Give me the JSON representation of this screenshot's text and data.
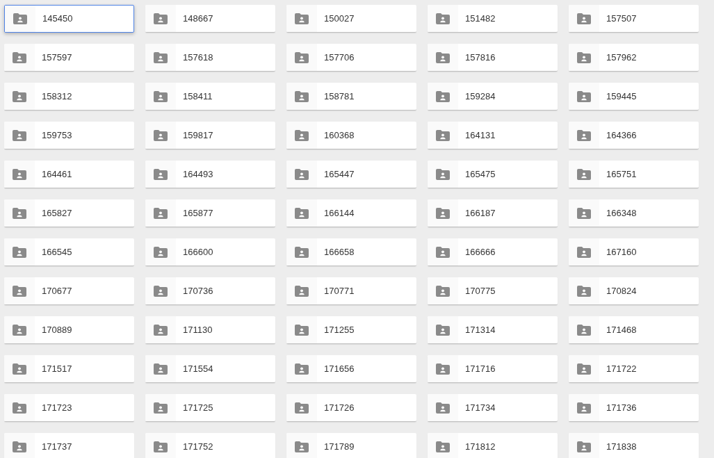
{
  "folders": [
    {
      "label": "145450",
      "selected": true
    },
    {
      "label": "148667",
      "selected": false
    },
    {
      "label": "150027",
      "selected": false
    },
    {
      "label": "151482",
      "selected": false
    },
    {
      "label": "157507",
      "selected": false
    },
    {
      "label": "157597",
      "selected": false
    },
    {
      "label": "157618",
      "selected": false
    },
    {
      "label": "157706",
      "selected": false
    },
    {
      "label": "157816",
      "selected": false
    },
    {
      "label": "157962",
      "selected": false
    },
    {
      "label": "158312",
      "selected": false
    },
    {
      "label": "158411",
      "selected": false
    },
    {
      "label": "158781",
      "selected": false
    },
    {
      "label": "159284",
      "selected": false
    },
    {
      "label": "159445",
      "selected": false
    },
    {
      "label": "159753",
      "selected": false
    },
    {
      "label": "159817",
      "selected": false
    },
    {
      "label": "160368",
      "selected": false
    },
    {
      "label": "164131",
      "selected": false
    },
    {
      "label": "164366",
      "selected": false
    },
    {
      "label": "164461",
      "selected": false
    },
    {
      "label": "164493",
      "selected": false
    },
    {
      "label": "165447",
      "selected": false
    },
    {
      "label": "165475",
      "selected": false
    },
    {
      "label": "165751",
      "selected": false
    },
    {
      "label": "165827",
      "selected": false
    },
    {
      "label": "165877",
      "selected": false
    },
    {
      "label": "166144",
      "selected": false
    },
    {
      "label": "166187",
      "selected": false
    },
    {
      "label": "166348",
      "selected": false
    },
    {
      "label": "166545",
      "selected": false
    },
    {
      "label": "166600",
      "selected": false
    },
    {
      "label": "166658",
      "selected": false
    },
    {
      "label": "166666",
      "selected": false
    },
    {
      "label": "167160",
      "selected": false
    },
    {
      "label": "170677",
      "selected": false
    },
    {
      "label": "170736",
      "selected": false
    },
    {
      "label": "170771",
      "selected": false
    },
    {
      "label": "170775",
      "selected": false
    },
    {
      "label": "170824",
      "selected": false
    },
    {
      "label": "170889",
      "selected": false
    },
    {
      "label": "171130",
      "selected": false
    },
    {
      "label": "171255",
      "selected": false
    },
    {
      "label": "171314",
      "selected": false
    },
    {
      "label": "171468",
      "selected": false
    },
    {
      "label": "171517",
      "selected": false
    },
    {
      "label": "171554",
      "selected": false
    },
    {
      "label": "171656",
      "selected": false
    },
    {
      "label": "171716",
      "selected": false
    },
    {
      "label": "171722",
      "selected": false
    },
    {
      "label": "171723",
      "selected": false
    },
    {
      "label": "171725",
      "selected": false
    },
    {
      "label": "171726",
      "selected": false
    },
    {
      "label": "171734",
      "selected": false
    },
    {
      "label": "171736",
      "selected": false
    },
    {
      "label": "171737",
      "selected": false
    },
    {
      "label": "171752",
      "selected": false
    },
    {
      "label": "171789",
      "selected": false
    },
    {
      "label": "171812",
      "selected": false
    },
    {
      "label": "171838",
      "selected": false
    }
  ]
}
